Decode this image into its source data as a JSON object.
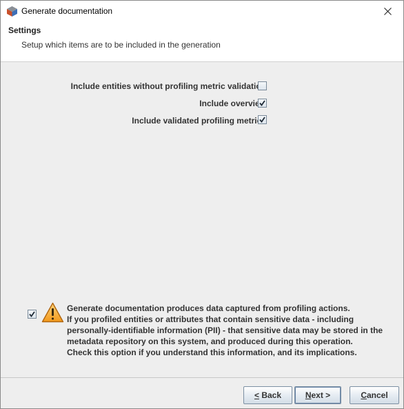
{
  "window": {
    "title": "Generate documentation"
  },
  "header": {
    "title": "Settings",
    "description": "Setup which items are to be included in the generation"
  },
  "options": [
    {
      "label": "Include entities without profiling metric validation",
      "checked": false
    },
    {
      "label": "Include overview",
      "checked": true
    },
    {
      "label": "Include validated profiling metrics",
      "checked": true
    }
  ],
  "warning": {
    "checked": true,
    "icon": "warning-icon",
    "lines": [
      "Generate documentation produces data captured from profiling actions.",
      "If you profiled entities or attributes that contain sensitive data - including",
      "personally-identifiable information (PII) - that sensitive data may be stored in the",
      "metadata repository on this system, and produced during this operation.",
      "Check this option if you understand this information, and its implications."
    ]
  },
  "buttons": {
    "back": {
      "mnemonic": "<",
      "rest": " Back"
    },
    "next": {
      "mnemonic": "N",
      "rest": "ext >"
    },
    "cancel": {
      "mnemonic": "C",
      "rest": "ancel"
    }
  },
  "colors": {
    "background": "#eeeeee",
    "header_background": "#ffffff",
    "button_border": "#7b8fa3"
  }
}
